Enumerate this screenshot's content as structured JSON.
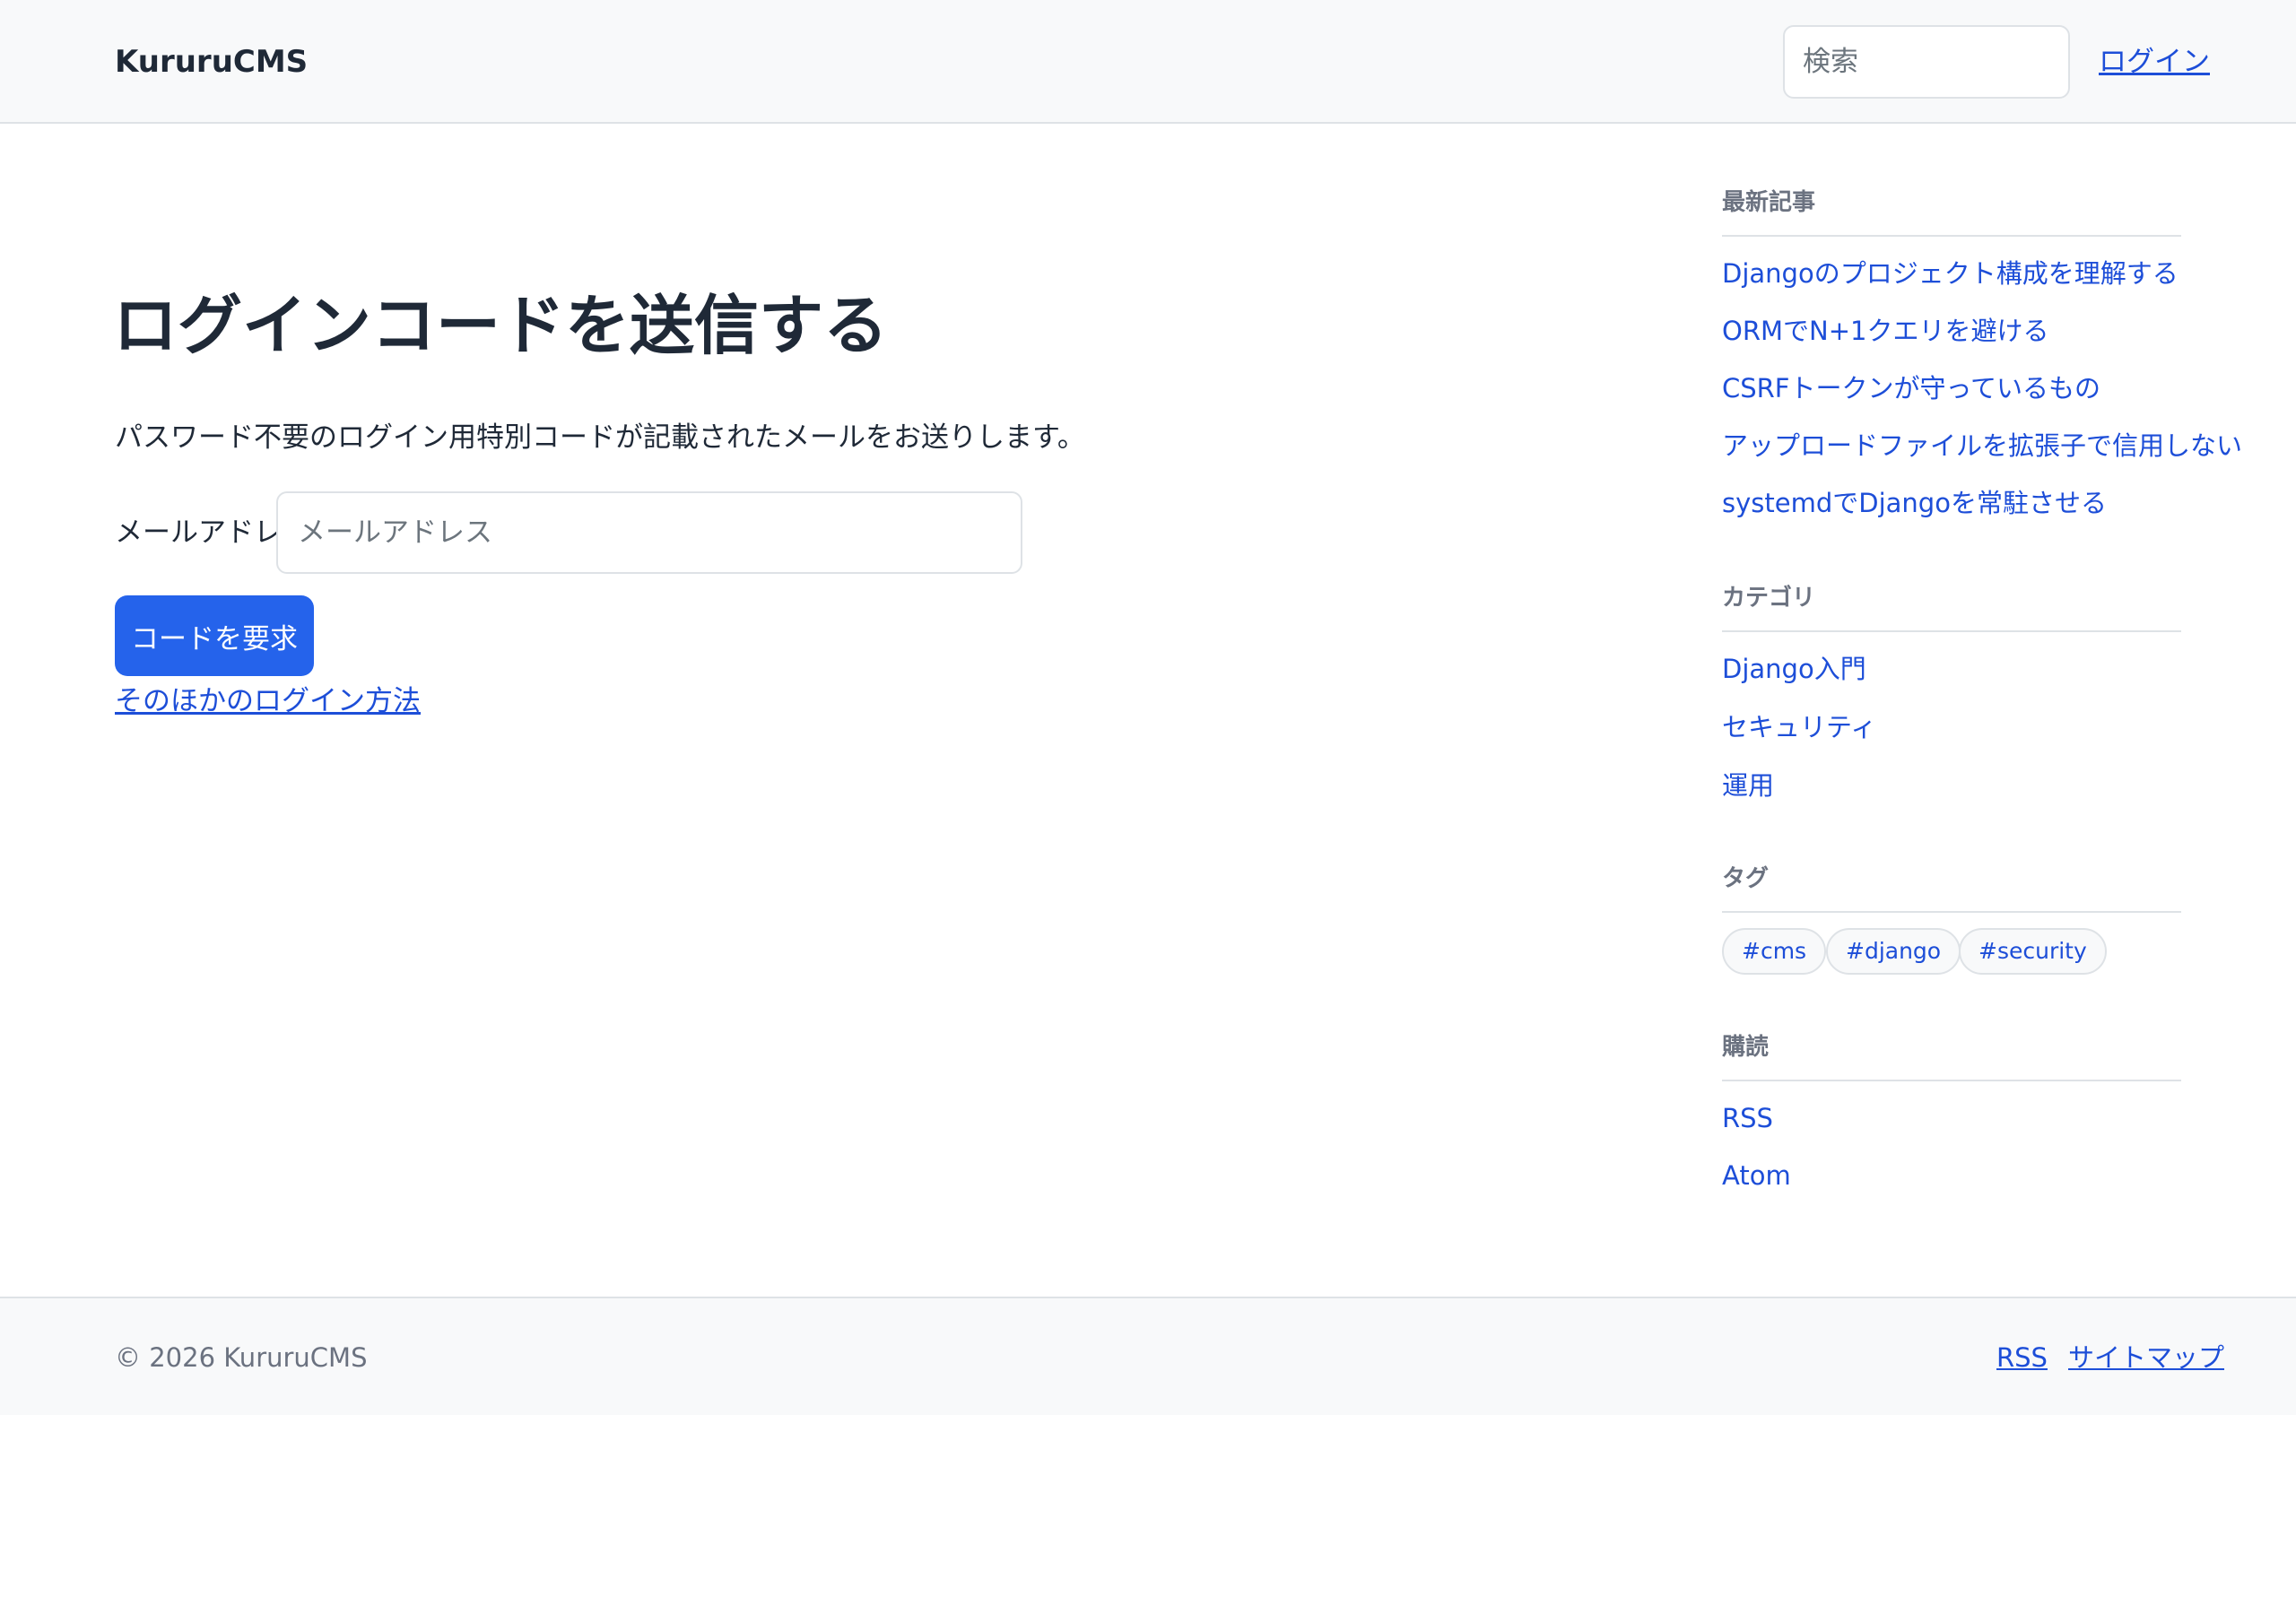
{
  "header": {
    "brand": "KururuCMS",
    "search_placeholder": "検索",
    "login_link": "ログイン"
  },
  "main": {
    "title": "ログインコードを送信する",
    "description": "パスワード不要のログイン用特別コードが記載されたメールをお送りします。",
    "email_label": "メールアドレス:",
    "email_placeholder": "メールアドレス",
    "submit_label": "コードを要求",
    "other_login_link": "そのほかのログイン方法"
  },
  "sidebar": {
    "recent": {
      "heading": "最新記事",
      "items": [
        "Djangoのプロジェクト構成を理解する",
        "ORMでN+1クエリを避ける",
        "CSRFトークンが守っているもの",
        "アップロードファイルを拡張子で信用しない",
        "systemdでDjangoを常駐させる"
      ]
    },
    "categories": {
      "heading": "カテゴリ",
      "items": [
        "Django入門",
        "セキュリティ",
        "運用"
      ]
    },
    "tags": {
      "heading": "タグ",
      "items": [
        "#cms",
        "#django",
        "#security"
      ]
    },
    "subscribe": {
      "heading": "購読",
      "items": [
        "RSS",
        "Atom"
      ]
    }
  },
  "footer": {
    "copyright": "© 2026 KururuCMS",
    "links": [
      "RSS",
      "サイトマップ"
    ]
  }
}
